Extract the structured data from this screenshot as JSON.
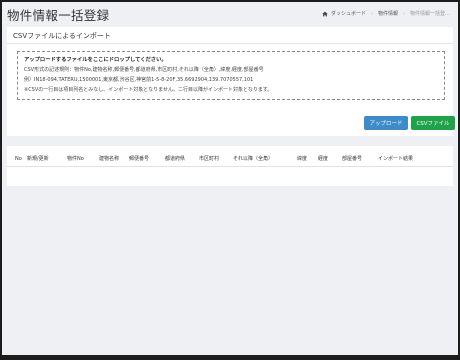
{
  "page_title": "物件情報一括登録",
  "breadcrumb": {
    "home": "ダッシュボード",
    "parent": "物件情報",
    "current": "物件情報一括登…"
  },
  "import_panel": {
    "title": "CSVファイルによるインポート",
    "dropzone": {
      "heading": "アップロードするファイルをここにドロップしてください。",
      "format_rule": "CSV形式の記述規則：物件No,建物名称,郵便番号,都道府県,市区町村,それ以降（全角）,緯度,経度,部屋番号",
      "example": "例）IN18-094,TATERU,1500001,東京都,渋谷区,神宮前1-5-8-20F,35.6692904,139.7070557,101",
      "note": "※CSVの一行目は項目列名とみなし、インポート対象となりません。二行目以降がインポート対象となります。"
    },
    "buttons": {
      "upload": "アップロード",
      "csv_file": "CSVファイル"
    }
  },
  "results_table": {
    "columns": [
      "No",
      "新規/更新",
      "物件No",
      "建物名称",
      "郵便番号",
      "都道府県",
      "市区町村",
      "それ以降（全角）",
      "緯度",
      "経度",
      "部屋番号",
      "インポート結果"
    ]
  },
  "colors": {
    "upload_button": "#3e8bc9",
    "csv_button": "#1ea24a",
    "page_background": "#eef0f3"
  },
  "icons": {
    "breadcrumb_home": "home-icon"
  }
}
